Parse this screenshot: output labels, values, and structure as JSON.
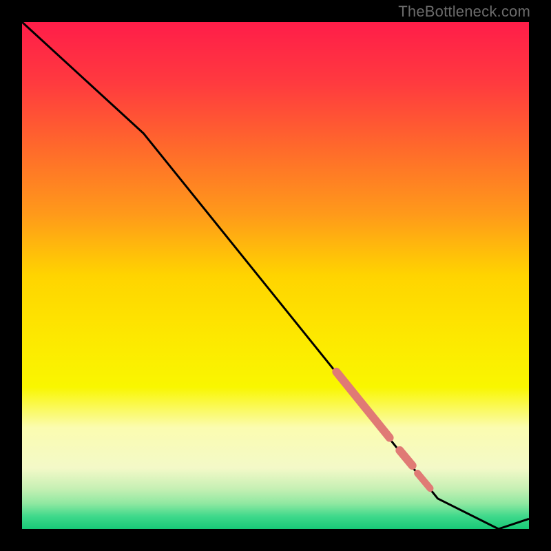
{
  "watermark": "TheBottleneck.com",
  "gradient_stops": [
    {
      "pct": 0,
      "color": "#ff1d49"
    },
    {
      "pct": 12,
      "color": "#ff3a3f"
    },
    {
      "pct": 25,
      "color": "#ff6a2b"
    },
    {
      "pct": 38,
      "color": "#ff9a1a"
    },
    {
      "pct": 50,
      "color": "#ffd400"
    },
    {
      "pct": 62,
      "color": "#fde800"
    },
    {
      "pct": 72,
      "color": "#f9f600"
    },
    {
      "pct": 80,
      "color": "#fbfcb0"
    },
    {
      "pct": 88,
      "color": "#f3f9c8"
    },
    {
      "pct": 92,
      "color": "#c7f0b4"
    },
    {
      "pct": 95,
      "color": "#8fe8a1"
    },
    {
      "pct": 97.5,
      "color": "#3fd98b"
    },
    {
      "pct": 100,
      "color": "#18c977"
    }
  ],
  "chart_data": {
    "type": "line",
    "title": "",
    "xlabel": "",
    "ylabel": "",
    "xlim": [
      0,
      100
    ],
    "ylim": [
      0,
      100
    ],
    "series": [
      {
        "name": "bottleneck-curve",
        "x": [
          0,
          24,
          82,
          94,
          100
        ],
        "y": [
          100,
          78,
          6,
          0,
          2
        ]
      }
    ],
    "highlight_segments": [
      {
        "x0": 62,
        "y0": 31.0,
        "x1": 72.5,
        "y1": 18.0,
        "thick": 12
      },
      {
        "x0": 74.5,
        "y0": 15.5,
        "x1": 77.0,
        "y1": 12.5,
        "thick": 12
      },
      {
        "x0": 78.0,
        "y0": 11.0,
        "x1": 80.5,
        "y1": 8.0,
        "thick": 10
      }
    ],
    "highlight_color": "#e07a75",
    "line_color": "#000000"
  }
}
